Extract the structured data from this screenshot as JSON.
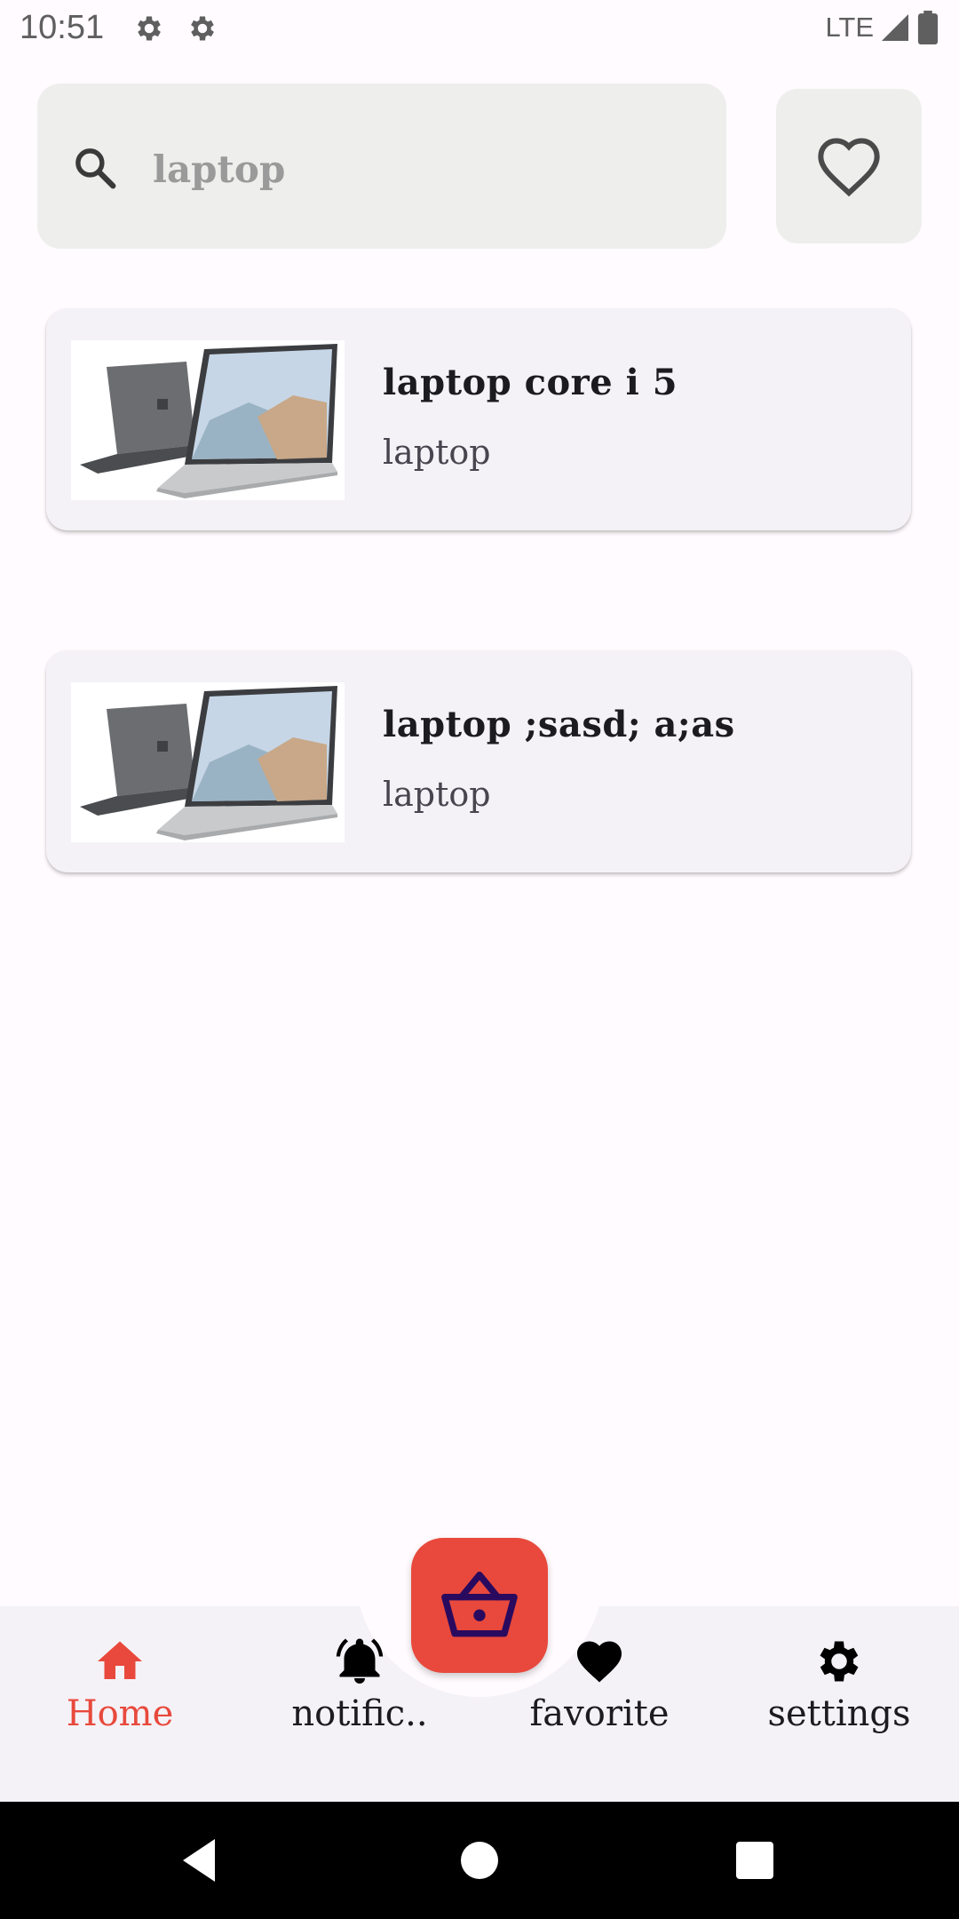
{
  "status_bar": {
    "time": "10:51",
    "network": "LTE"
  },
  "search": {
    "value": "laptop",
    "placeholder": "laptop"
  },
  "results": [
    {
      "title": "laptop core i 5",
      "category": "laptop"
    },
    {
      "title": "laptop ;sasd; a;as",
      "category": "laptop"
    }
  ],
  "bottom_nav": {
    "items": [
      {
        "label": "Home",
        "icon": "home-icon",
        "active": true
      },
      {
        "label": "notific..",
        "icon": "bell-icon",
        "active": false
      },
      {
        "label": "favorite",
        "icon": "heart-icon",
        "active": false
      },
      {
        "label": "settings",
        "icon": "gear-icon",
        "active": false
      }
    ],
    "fab_icon": "basket-icon"
  },
  "colors": {
    "accent": "#e8493c",
    "search_bg": "#eeefed",
    "card_bg": "#f4f2f7",
    "fab_icon": "#2a0a5e"
  }
}
